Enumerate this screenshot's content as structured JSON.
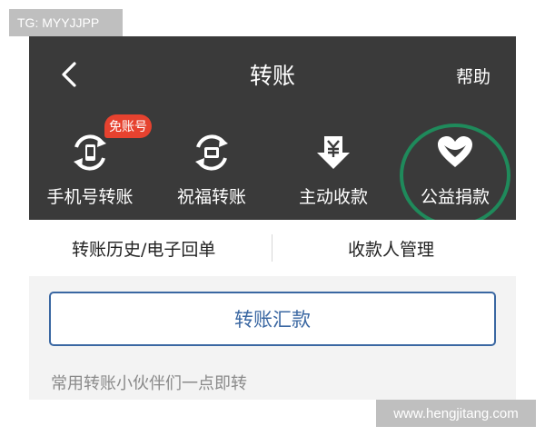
{
  "corner_tag": "TG: MYYJJPP",
  "header": {
    "title": "转账",
    "help_label": "帮助",
    "back_icon": "chevron-left-icon"
  },
  "actions": [
    {
      "label": "手机号转账",
      "icon": "phone-transfer-icon",
      "badge": "免账号"
    },
    {
      "label": "祝福转账",
      "icon": "gift-transfer-icon"
    },
    {
      "label": "主动收款",
      "icon": "yuan-receive-icon"
    },
    {
      "label": "公益捐款",
      "icon": "heart-donation-icon"
    }
  ],
  "links": {
    "history": "转账历史/电子回单",
    "payee_management": "收款人管理"
  },
  "main": {
    "transfer_button": "转账汇款",
    "hint": "常用转账小伙伴们一点即转"
  },
  "watermark": "www.hengjitang.com",
  "colors": {
    "header_bg": "#3a3a3a",
    "badge_red": "#e6422f",
    "highlight_ring": "#1f8a5b",
    "button_blue": "#3a67a2"
  }
}
